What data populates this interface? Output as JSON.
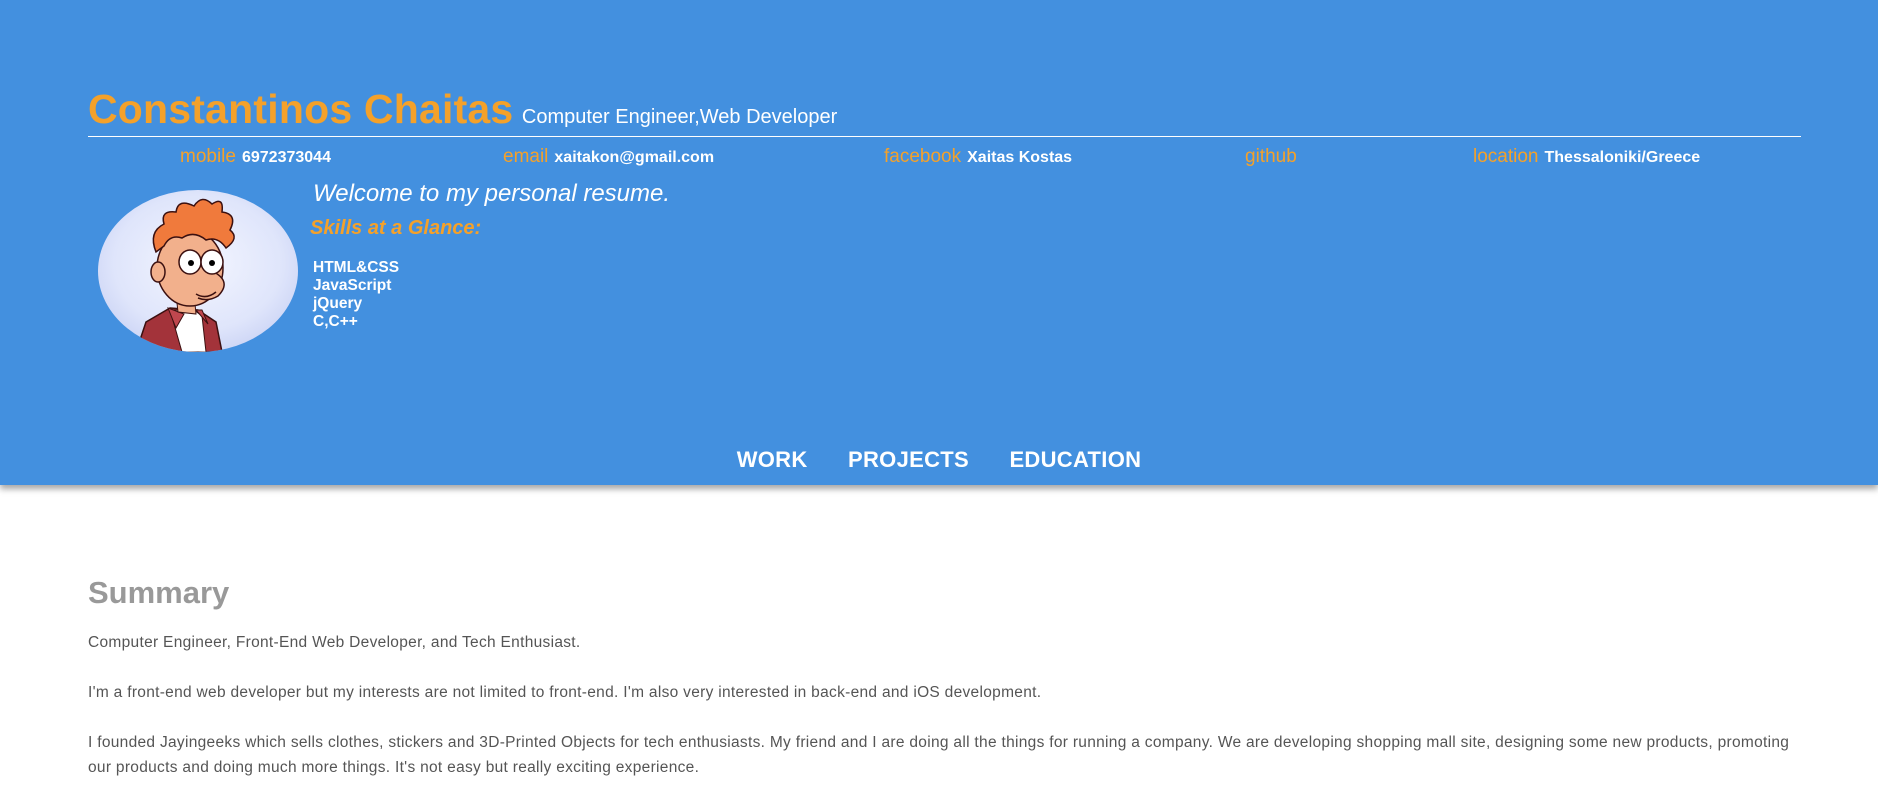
{
  "header": {
    "name": "Constantinos Chaitas",
    "role": "Computer Engineer,Web Developer",
    "colors": {
      "background": "#4390df",
      "accent": "#f4a12a",
      "text": "#ffffff"
    }
  },
  "contacts": [
    {
      "label": "mobile",
      "value": "6972373044"
    },
    {
      "label": "email",
      "value": "xaitakon@gmail.com"
    },
    {
      "label": "facebook",
      "value": "Xaitas Kostas"
    },
    {
      "label": "github",
      "value": ""
    },
    {
      "label": "location",
      "value": "Thessaloniki/Greece"
    }
  ],
  "profile": {
    "avatar_icon": "cartoon-avatar-icon",
    "welcome": "Welcome to my personal resume.",
    "skills_heading": "Skills at a Glance:",
    "skills": [
      "HTML&CSS",
      "JavaScript",
      "jQuery",
      "C,C++"
    ]
  },
  "nav": {
    "items": [
      "WORK",
      "PROJECTS",
      "EDUCATION"
    ]
  },
  "summary": {
    "title": "Summary",
    "paragraphs": [
      "Computer Engineer, Front-End Web Developer, and Tech Enthusiast.",
      "I'm a front-end web developer but my interests are not limited to front-end. I'm also very interested in back-end and iOS development.",
      "I founded Jayingeeks which sells clothes, stickers and 3D-Printed Objects for tech enthusiasts. My friend and I are doing all the things for running a company. We are developing shopping mall site, designing some new products, promoting our products and doing much more things. It's not easy but really exciting experience."
    ]
  }
}
